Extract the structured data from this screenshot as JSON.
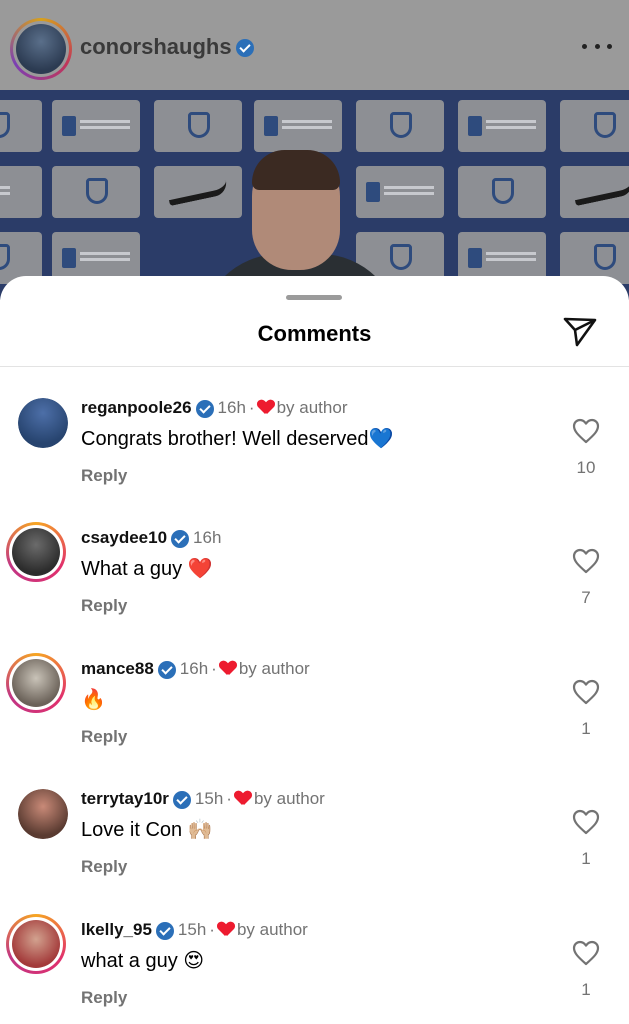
{
  "post": {
    "username": "conorshaughs",
    "verified_icon": "verified-badge-icon",
    "more_icon": "more-horizontal-icon"
  },
  "sheet": {
    "title": "Comments",
    "share_icon": "send-icon"
  },
  "comments": [
    {
      "username": "reganpoole26",
      "time": "16h",
      "liked_by_author": true,
      "author_text": "by author",
      "text": "Congrats brother! Well deserved💙",
      "reply": "Reply",
      "likes": "10",
      "avatar_ring": false
    },
    {
      "username": "csaydee10",
      "time": "16h",
      "liked_by_author": false,
      "author_text": "",
      "text": "What a guy ❤️",
      "reply": "Reply",
      "likes": "7",
      "avatar_ring": true
    },
    {
      "username": "mance88",
      "time": "16h",
      "liked_by_author": true,
      "author_text": "by author",
      "text": "🔥",
      "reply": "Reply",
      "likes": "1",
      "avatar_ring": true
    },
    {
      "username": "terrytay10r",
      "time": "15h",
      "liked_by_author": true,
      "author_text": "by author",
      "text": "Love it Con 🙌🏼",
      "reply": "Reply",
      "likes": "1",
      "avatar_ring": false
    },
    {
      "username": "lkelly_95",
      "time": "15h",
      "liked_by_author": true,
      "author_text": "by author",
      "text": "what a guy 😍",
      "reply": "Reply",
      "likes": "1",
      "avatar_ring": true
    }
  ],
  "colors": {
    "accent_verified": "#2b6fb8",
    "heart_red": "#ed1b2f",
    "secondary_text": "#737373"
  }
}
